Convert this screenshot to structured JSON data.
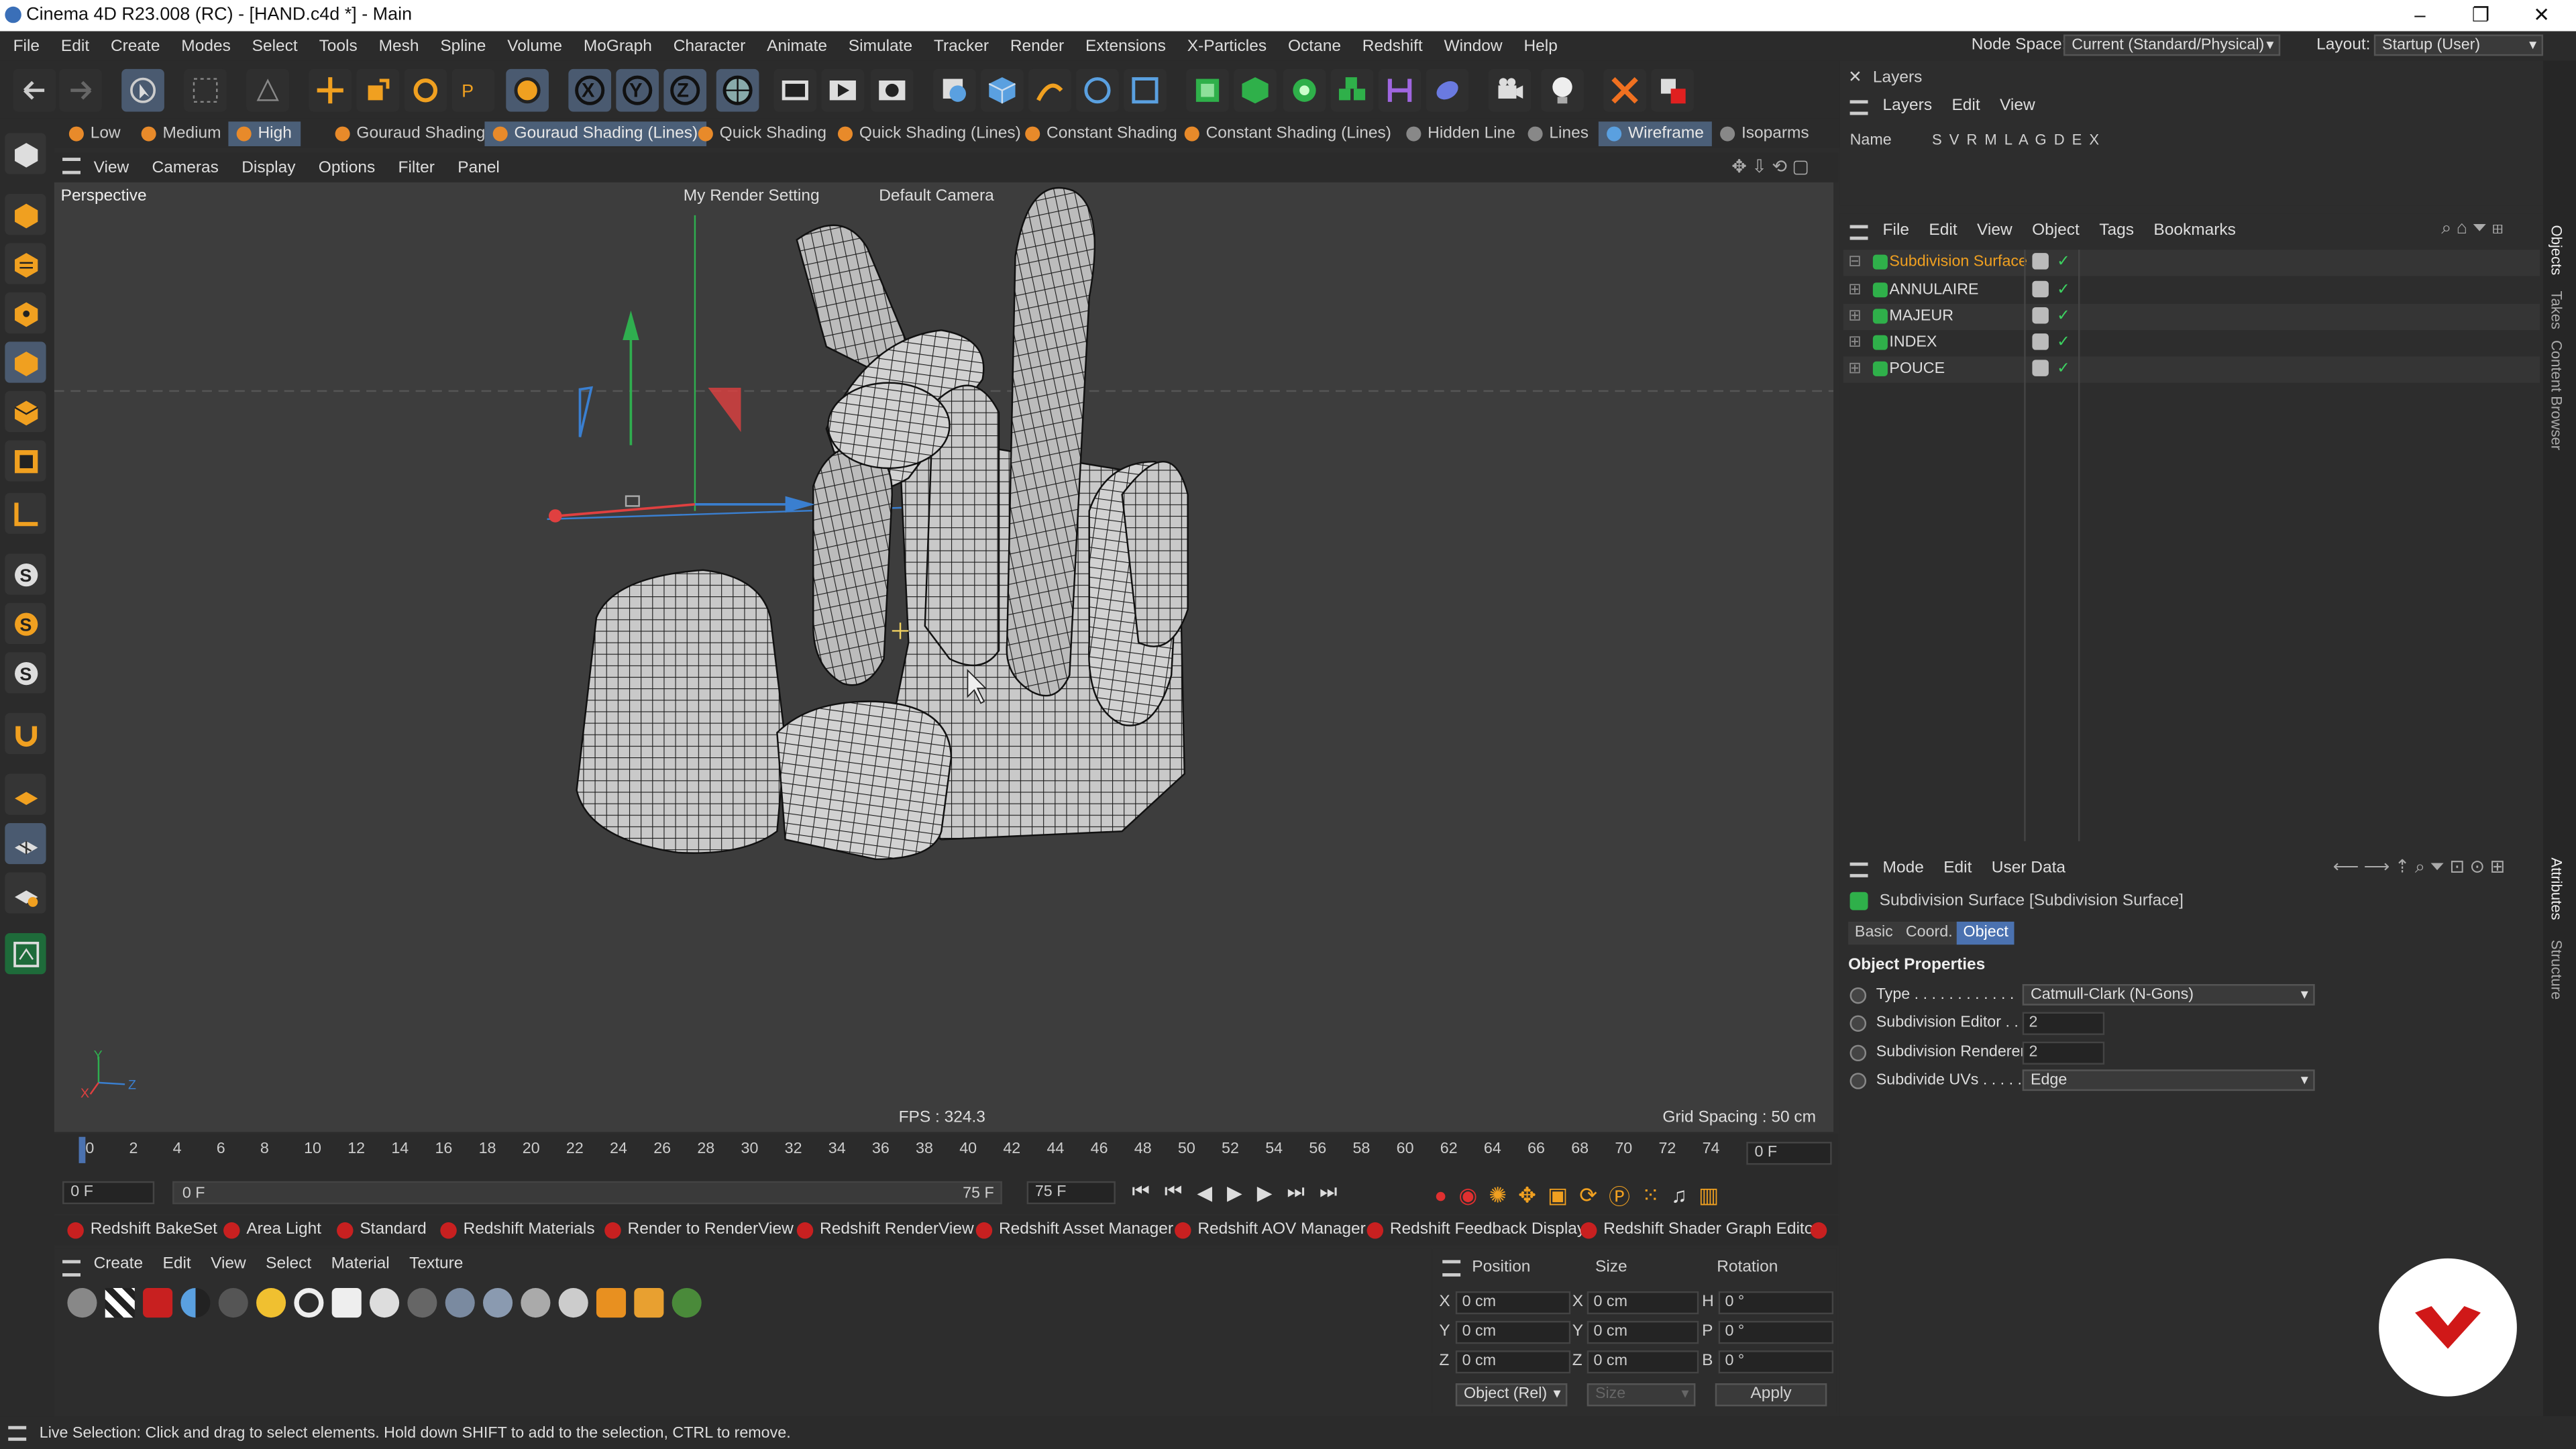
{
  "app": {
    "title": "Cinema 4D R23.008 (RC) - [HAND.c4d *] - Main"
  },
  "menu": [
    "File",
    "Edit",
    "Create",
    "Modes",
    "Select",
    "Tools",
    "Mesh",
    "Spline",
    "Volume",
    "MoGraph",
    "Character",
    "Animate",
    "Simulate",
    "Tracker",
    "Render",
    "Extensions",
    "X-Particles",
    "Octane",
    "Redshift",
    "Window",
    "Help"
  ],
  "nodespace": {
    "label": "Node Space:",
    "value": "Current (Standard/Physical)"
  },
  "layout": {
    "label": "Layout:",
    "value": "Startup (User)"
  },
  "display_modes": [
    "Low",
    "Medium",
    "High",
    "Gouraud Shading",
    "Gouraud Shading (Lines)",
    "Quick Shading",
    "Quick Shading (Lines)",
    "Constant Shading",
    "Constant Shading (Lines)",
    "Hidden Line",
    "Lines",
    "Wireframe",
    "Isoparms"
  ],
  "vp_menu": [
    "View",
    "Cameras",
    "Display",
    "Options",
    "Filter",
    "Panel"
  ],
  "viewport": {
    "name": "Perspective",
    "render_setting": "My Render Setting",
    "camera": "Default Camera",
    "fps": "FPS : 324.3",
    "grid": "Grid Spacing : 50 cm",
    "axis_y": "Y",
    "axis_x": "X",
    "axis_z": "Z"
  },
  "timeline": {
    "ticks": [
      "0",
      "2",
      "4",
      "6",
      "8",
      "10",
      "12",
      "14",
      "16",
      "18",
      "20",
      "22",
      "24",
      "26",
      "28",
      "30",
      "32",
      "34",
      "36",
      "38",
      "40",
      "42",
      "44",
      "46",
      "48",
      "50",
      "52",
      "54",
      "56",
      "58",
      "60",
      "62",
      "64",
      "66",
      "68",
      "70",
      "72",
      "74"
    ],
    "current": "0 F"
  },
  "transport": {
    "start": "0 F",
    "range_start": "0 F",
    "range_end": "75 F",
    "end": "75 F"
  },
  "shelf": [
    "Redshift BakeSet",
    "Area Light",
    "Standard",
    "Redshift Materials",
    "Render to RenderView",
    "Redshift RenderView",
    "Redshift Asset Manager",
    "Redshift AOV Manager",
    "Redshift Feedback Display",
    "Redshift Shader Graph Editor"
  ],
  "mat_menu": [
    "Create",
    "Edit",
    "View",
    "Select",
    "Material",
    "Texture"
  ],
  "coord": {
    "h_position": "Position",
    "h_size": "Size",
    "h_rotation": "Rotation",
    "rows": [
      {
        "a": "X",
        "p": "0 cm",
        "b": "X",
        "s": "0 cm",
        "c": "H",
        "r": "0 °"
      },
      {
        "a": "Y",
        "p": "0 cm",
        "b": "Y",
        "s": "0 cm",
        "c": "P",
        "r": "0 °"
      },
      {
        "a": "Z",
        "p": "0 cm",
        "b": "Z",
        "s": "0 cm",
        "c": "B",
        "r": "0 °"
      }
    ],
    "mode": "Object (Rel)",
    "size_mode": "Size",
    "apply": "Apply"
  },
  "status": "Live Selection: Click and drag to select elements. Hold down SHIFT to add to the selection, CTRL to remove.",
  "layers": {
    "title": "Layers",
    "menu": [
      "Layers",
      "Edit",
      "View"
    ],
    "name_col": "Name",
    "flags": "S V R M L A G D E X"
  },
  "objects": {
    "menu": [
      "File",
      "Edit",
      "View",
      "Object",
      "Tags",
      "Bookmarks"
    ],
    "items": [
      "Subdivision Surface",
      "ANNULAIRE",
      "MAJEUR",
      "INDEX",
      "POUCE"
    ]
  },
  "attrs": {
    "menu": [
      "Mode",
      "Edit",
      "User Data"
    ],
    "object": "Subdivision Surface [Subdivision Surface]",
    "tabs": [
      "Basic",
      "Coord.",
      "Object"
    ],
    "section": "Object Properties",
    "type_label": "Type . . . . . . . . . . . .",
    "type_value": "Catmull-Clark (N-Gons)",
    "sub_editor_label": "Subdivision Editor . .",
    "sub_editor_value": "2",
    "sub_renderer_label": "Subdivision Renderer",
    "sub_renderer_value": "2",
    "uvs_label": "Subdivide UVs . . . . .",
    "uvs_value": "Edge"
  },
  "right_tabs": [
    "Objects",
    "Takes",
    "Content Browser",
    "Attributes",
    "Structure"
  ],
  "colors": {
    "accent": "#4b72b0",
    "highlight": "#f0a020",
    "object_icon": "#2fb04a",
    "logo": "#d01818"
  }
}
